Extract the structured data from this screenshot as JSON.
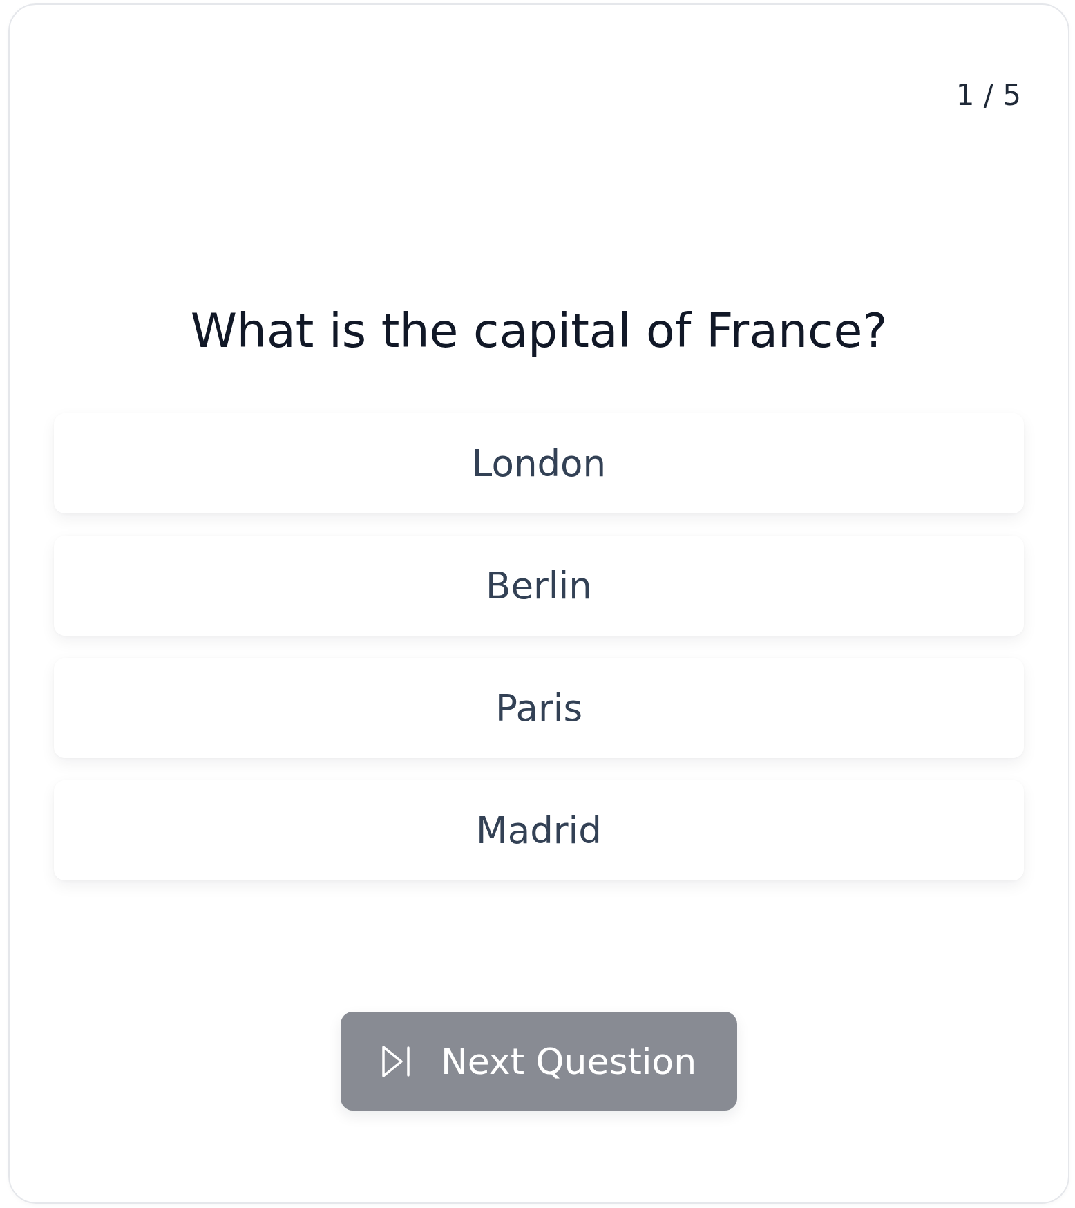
{
  "counter": "1 / 5",
  "question": "What is the capital of France?",
  "options": [
    {
      "label": "London",
      "selected": false
    },
    {
      "label": "Berlin",
      "selected": false
    },
    {
      "label": "Paris",
      "selected": false
    },
    {
      "label": "Madrid",
      "selected": false
    }
  ],
  "next_button": {
    "label": "Next Question",
    "disabled": true
  }
}
